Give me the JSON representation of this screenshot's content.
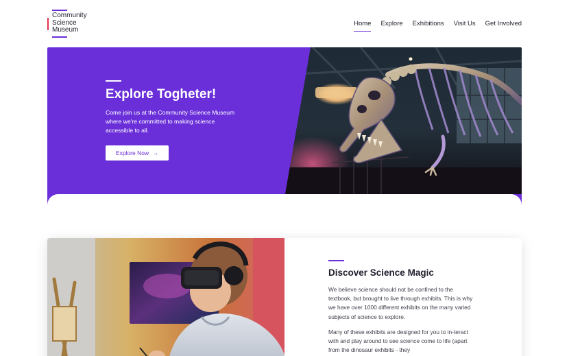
{
  "logo": {
    "lines": [
      "Community",
      "Science",
      "Museum"
    ]
  },
  "nav": {
    "items": [
      {
        "label": "Home",
        "active": true
      },
      {
        "label": "Explore",
        "active": false
      },
      {
        "label": "Exhibitions",
        "active": false
      },
      {
        "label": "Visit Us",
        "active": false
      },
      {
        "label": "Get Involved",
        "active": false
      }
    ]
  },
  "hero": {
    "title": "Explore Togheter!",
    "description": "Come join us at the Community Science Museum where we're committed to making science accessible to all.",
    "button_label": "Explore Now",
    "button_icon": "arrow-right-icon",
    "image": "dinosaur-skeleton-photo"
  },
  "feature": {
    "title": "Discover Science Magic",
    "paragraph1": "We believe science should not be confined to the textbook, but brought to live through exhibits. This is why we have over 1000 different exhibits on the many varied subjects of science to explore.",
    "paragraph2": "Many of these exhibits are designed for you to in-teract with and play around to see science come to life (apart from the dinosaur exhibits - they",
    "image": "vr-headset-visitor-photo"
  },
  "colors": {
    "accent": "#6b2fd6",
    "hero_bg": "#6a2fd9",
    "logo_red": "#e0304a"
  }
}
